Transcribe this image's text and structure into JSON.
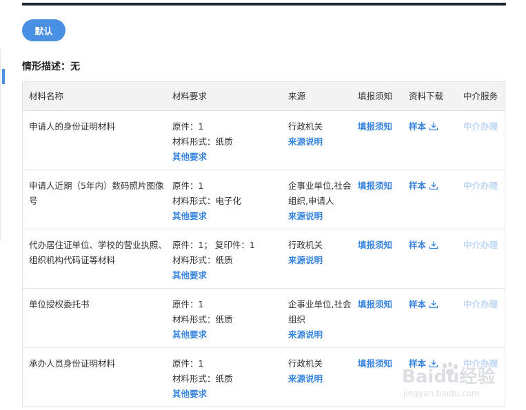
{
  "toolbar": {
    "default_label": "默认"
  },
  "situation": {
    "label": "情形描述：无"
  },
  "table": {
    "headers": [
      "材料名称",
      "材料要求",
      "来源",
      "填报须知",
      "资料下载",
      "中介服务"
    ],
    "rows": [
      {
        "name": "申请人的身份证明材料",
        "req_line1": "原件：1",
        "req_line2": "材料形式：纸质",
        "req_more": "其他要求",
        "source": "行政机关",
        "source_link": "来源说明",
        "notice": "填报须知",
        "download": "样本",
        "agency": "中介办理"
      },
      {
        "name": "申请人近期（5年内）数码照片图像号",
        "req_line1": "原件：1",
        "req_line2": "材料形式：电子化",
        "req_more": "其他要求",
        "source": "企事业单位,社会组织,申请人",
        "source_link": "来源说明",
        "notice": "填报须知",
        "download": "样本",
        "agency": "中介办理"
      },
      {
        "name": "代办居住证单位、学校的营业执照、组织机构代码证等材料",
        "req_line1": "原件：1； 复印件：1",
        "req_line2": "材料形式：纸质",
        "req_more": "其他要求",
        "source": "行政机关",
        "source_link": "来源说明",
        "notice": "填报须知",
        "download": "样本",
        "agency": "中介办理"
      },
      {
        "name": "单位授权委托书",
        "req_line1": "原件：1",
        "req_line2": "材料形式：纸质",
        "req_more": "其他要求",
        "source": "企事业单位,社会组织",
        "source_link": "来源说明",
        "notice": "填报须知",
        "download": "样本",
        "agency": "中介办理"
      },
      {
        "name": "承办人员身份证明材料",
        "req_line1": "原件：1",
        "req_line2": "材料形式：纸质",
        "req_more": "其他要求",
        "source": "行政机关",
        "source_link": "来源说明",
        "notice": "填报须知",
        "download": "样本",
        "agency": "中介办理"
      }
    ]
  },
  "watermark": {
    "brand": "Baidu经验",
    "url": "jingyan.baidu.com"
  },
  "colors": {
    "accent": "#4a90e2",
    "link": "#3a86e0",
    "disabled": "#bcd7f4",
    "header_bg": "#f3f3f3",
    "top_bar": "#1f2633"
  }
}
